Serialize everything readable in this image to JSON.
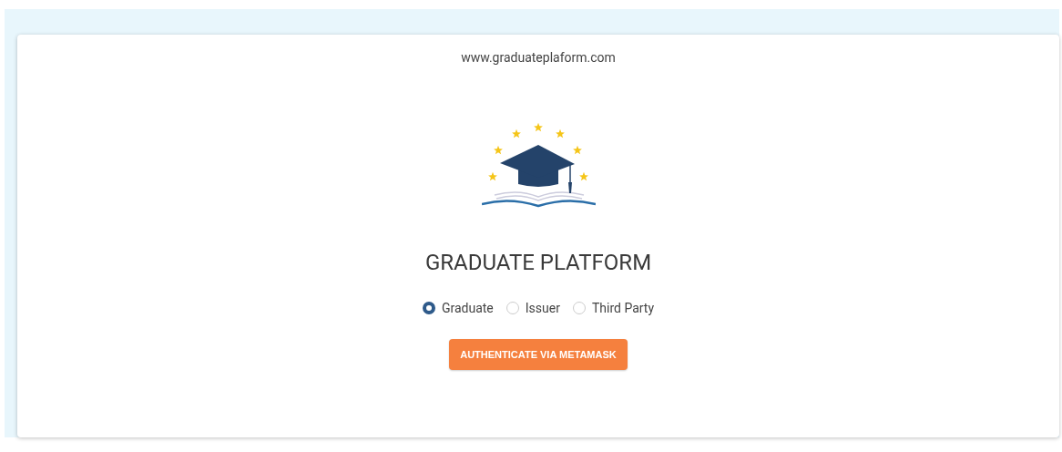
{
  "url": "www.graduateplaform.com",
  "title": "GRADUATE PLATFORM",
  "roles": [
    {
      "label": "Graduate",
      "selected": true
    },
    {
      "label": "Issuer",
      "selected": false
    },
    {
      "label": "Third Party",
      "selected": false
    }
  ],
  "button": "AUTHENTICATE VIA METAMASK"
}
